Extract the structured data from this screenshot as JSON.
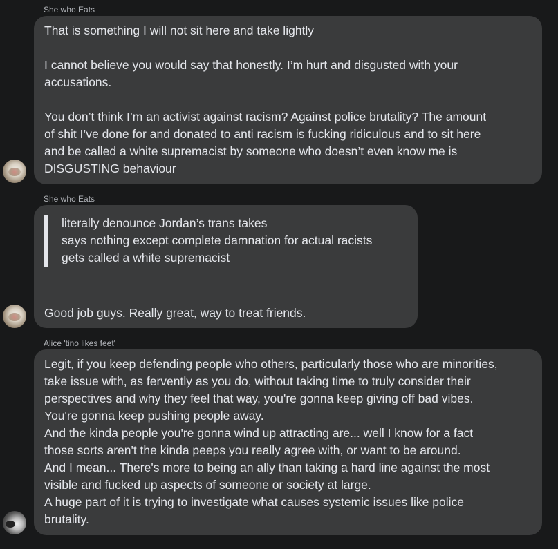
{
  "messages": [
    {
      "sender": "She who Eats",
      "lines": [
        "That is something I will not sit here and take lightly",
        "",
        "I cannot believe you would say that honestly. I’m hurt and disgusted with your",
        "accusations.",
        "",
        "You don’t think I’m an activist against racism? Against police brutality? The amount",
        "of shit I’ve done for and donated to anti racism is fucking ridiculous and to sit here",
        "and be called a white supremacist by someone who doesn’t even know me is",
        "DISGUSTING behaviour"
      ]
    },
    {
      "sender": "She who Eats",
      "quote_lines": [
        "literally denounce Jordan’s trans takes",
        "says nothing except complete damnation for actual racists",
        "gets called a white supremacist"
      ],
      "body": "Good job guys. Really great, way to treat friends."
    },
    {
      "sender": "Alice 'tino likes feet'",
      "lines": [
        "Legit, if you keep defending people who others, particularly those who are minorities,",
        "take issue with, as fervently as you do, without taking time to truly consider their",
        "perspectives and why they feel that way, you're gonna keep giving off bad vibes.",
        "You're gonna keep pushing people away.",
        "And the kinda people you're gonna wind up attracting are... well I know for a fact",
        "those sorts aren't the kinda peeps you really agree with, or want to be around.",
        "And I mean... There's more to being an ally than taking a hard line against the most",
        "visible and fucked up aspects of someone or society at large.",
        "A huge part of it is trying to investigate what causes systemic issues like police",
        "brutality."
      ]
    }
  ],
  "colors": {
    "background": "#18191a",
    "bubble": "#3a3b3c",
    "text": "#e4e6eb",
    "sender": "#b0b3b8"
  }
}
